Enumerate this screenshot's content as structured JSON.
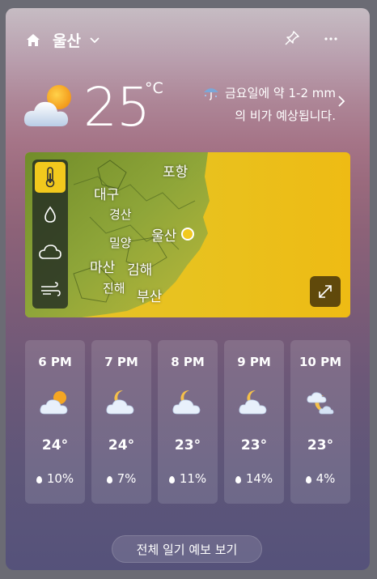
{
  "header": {
    "city": "울산",
    "home_icon": "home-icon",
    "chevron_icon": "chevron-down-icon",
    "pin_icon": "pin-icon",
    "more_icon": "more-icon"
  },
  "current": {
    "temperature": "25",
    "unit": "°C",
    "condition_icon": "partly-cloudy-icon",
    "forecast_line1": "금요일에 약 1-2 mm",
    "forecast_line2": "의 비가 예상됩니다."
  },
  "map": {
    "labels": [
      "포항",
      "대구",
      "경산",
      "울산",
      "밀양",
      "마산",
      "김해",
      "진해",
      "부산"
    ],
    "layers": [
      "thermometer-icon",
      "droplet-icon",
      "cloud-icon",
      "wind-icon"
    ],
    "active_layer": "thermometer-icon",
    "colors": {
      "warm": "#e8c21f",
      "panel_active": "#f2c91d"
    }
  },
  "hourly": [
    {
      "time": "6 PM",
      "temp": "24°",
      "precip": "10%",
      "icon": "partly-cloudy-sun-icon"
    },
    {
      "time": "7 PM",
      "temp": "24°",
      "precip": "7%",
      "icon": "partly-cloudy-moon-icon"
    },
    {
      "time": "8 PM",
      "temp": "23°",
      "precip": "11%",
      "icon": "partly-cloudy-moon-icon"
    },
    {
      "time": "9 PM",
      "temp": "23°",
      "precip": "14%",
      "icon": "partly-cloudy-moon-icon"
    },
    {
      "time": "10 PM",
      "temp": "23°",
      "precip": "4%",
      "icon": "mostly-cloudy-moon-icon"
    }
  ],
  "footer": {
    "full_forecast_label": "전체 일기 예보 보기"
  }
}
